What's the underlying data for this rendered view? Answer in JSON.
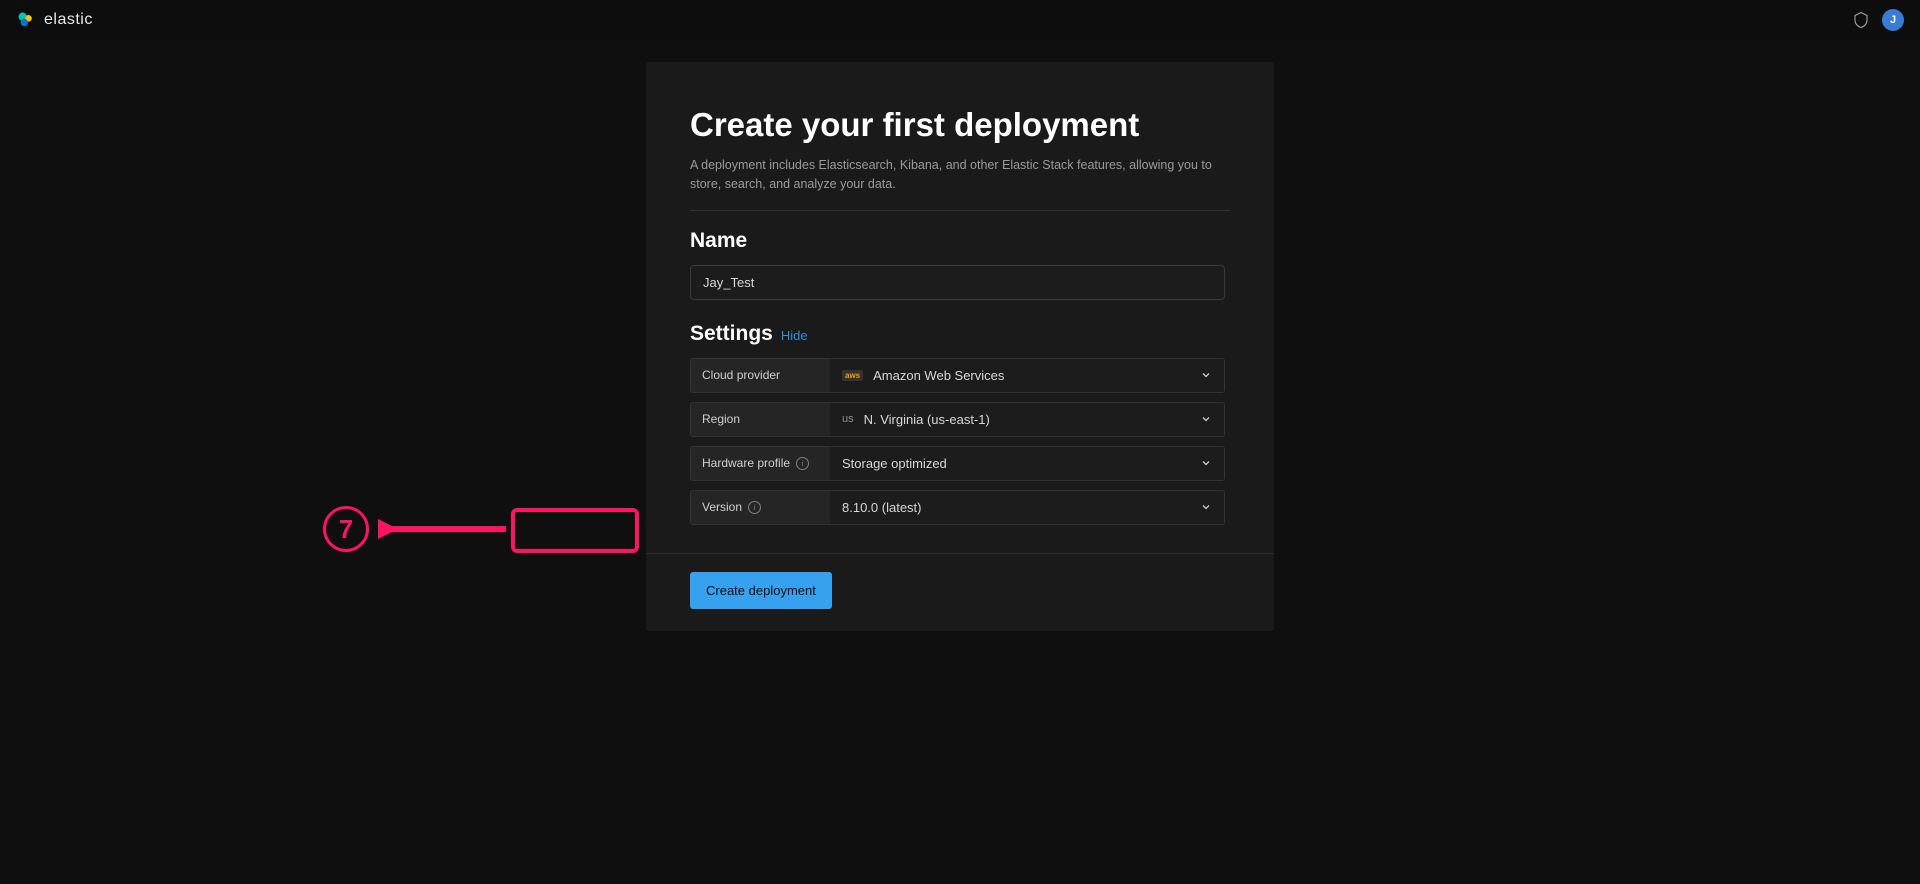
{
  "header": {
    "brand": "elastic",
    "avatar_initial": "J"
  },
  "card": {
    "title": "Create your first deployment",
    "subtitle": "A deployment includes Elasticsearch, Kibana, and other Elastic Stack features, allowing you to store, search, and analyze your data."
  },
  "name_section": {
    "label": "Name",
    "value": "Jay_Test"
  },
  "settings_section": {
    "label": "Settings",
    "hide_text": "Hide"
  },
  "settings": {
    "cloud_provider": {
      "label": "Cloud provider",
      "badge": "aws",
      "value": "Amazon Web Services"
    },
    "region": {
      "label": "Region",
      "badge": "us",
      "value": "N. Virginia (us-east-1)"
    },
    "hardware_profile": {
      "label": "Hardware profile",
      "value": "Storage optimized"
    },
    "version": {
      "label": "Version",
      "value": "8.10.0 (latest)"
    }
  },
  "footer": {
    "create_button": "Create deployment"
  },
  "annotation": {
    "number": "7"
  }
}
